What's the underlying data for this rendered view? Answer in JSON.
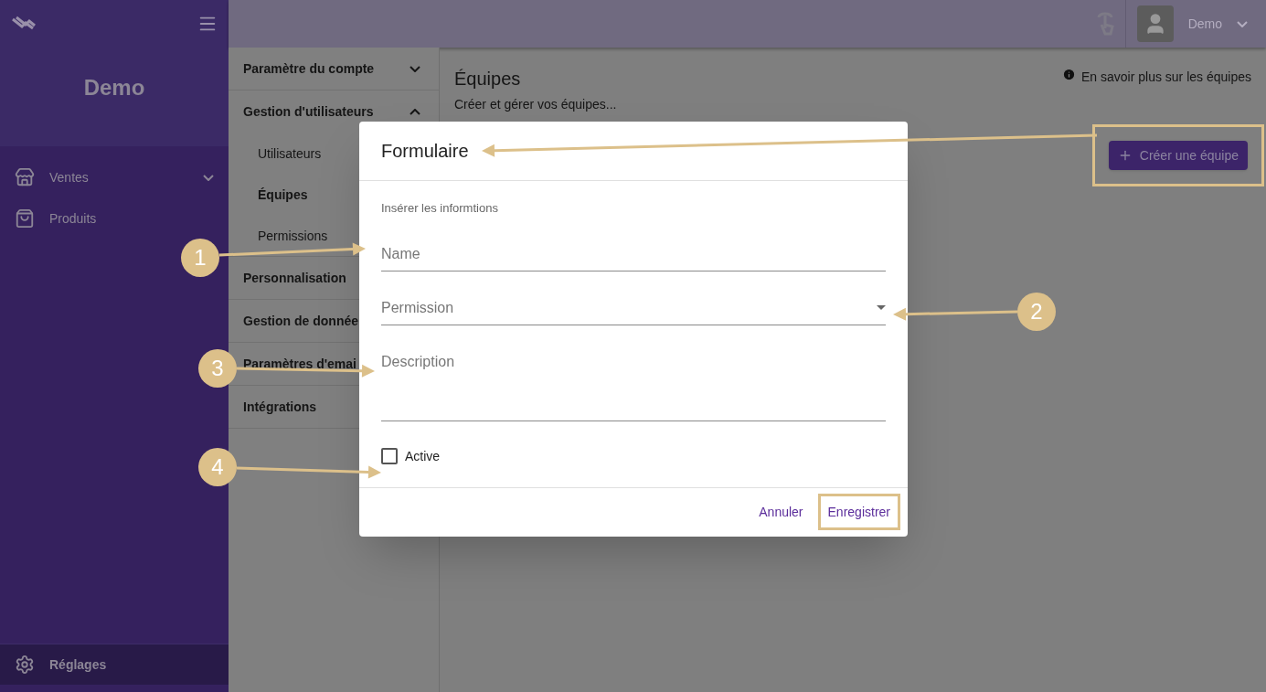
{
  "sidebar": {
    "brand": "Demo",
    "items": [
      {
        "label": "Ventes",
        "kind": "group"
      },
      {
        "label": "Produits",
        "kind": "link"
      }
    ],
    "footer": {
      "label": "Réglages",
      "selected": true
    }
  },
  "topbar": {
    "user_name": "Demo"
  },
  "settings_nav": {
    "sections": [
      {
        "label": "Paramètre du compte",
        "kind": "collapsible",
        "expanded": false
      },
      {
        "label": "Gestion d'utilisateurs",
        "kind": "collapsible",
        "expanded": true,
        "children": [
          {
            "label": "Utilisateurs",
            "selected": false
          },
          {
            "label": "Équipes",
            "selected": true
          },
          {
            "label": "Permissions",
            "selected": false
          }
        ]
      },
      {
        "label": "Personnalisation",
        "kind": "plain",
        "expanded": false
      },
      {
        "label": "Gestion de donnée",
        "kind": "plain",
        "expanded": false
      },
      {
        "label": "Paramètres d'emai",
        "kind": "plain",
        "expanded": false
      },
      {
        "label": "Intégrations",
        "kind": "plain",
        "expanded": false
      }
    ]
  },
  "page": {
    "title": "Équipes",
    "subtitle": "Créer et gérer vos équipes...",
    "help_link": "En savoir plus sur les équipes",
    "create_button": {
      "label": "Créer une équipe",
      "highlighted": true
    }
  },
  "dialog": {
    "title": "Formulaire",
    "subtitle": "Insérer les informtions",
    "fields": [
      {
        "kind": "text",
        "placeholder": "Name"
      },
      {
        "kind": "select",
        "placeholder": "Permission"
      },
      {
        "kind": "textarea",
        "placeholder": "Description"
      },
      {
        "kind": "checkbox",
        "label": "Active",
        "checked": false
      }
    ],
    "actions": [
      {
        "label": "Annuler",
        "highlighted": false
      },
      {
        "label": "Enregistrer",
        "highlighted": true
      }
    ]
  },
  "callouts": [
    {
      "number": "1"
    },
    {
      "number": "2"
    },
    {
      "number": "3"
    },
    {
      "number": "4"
    }
  ]
}
